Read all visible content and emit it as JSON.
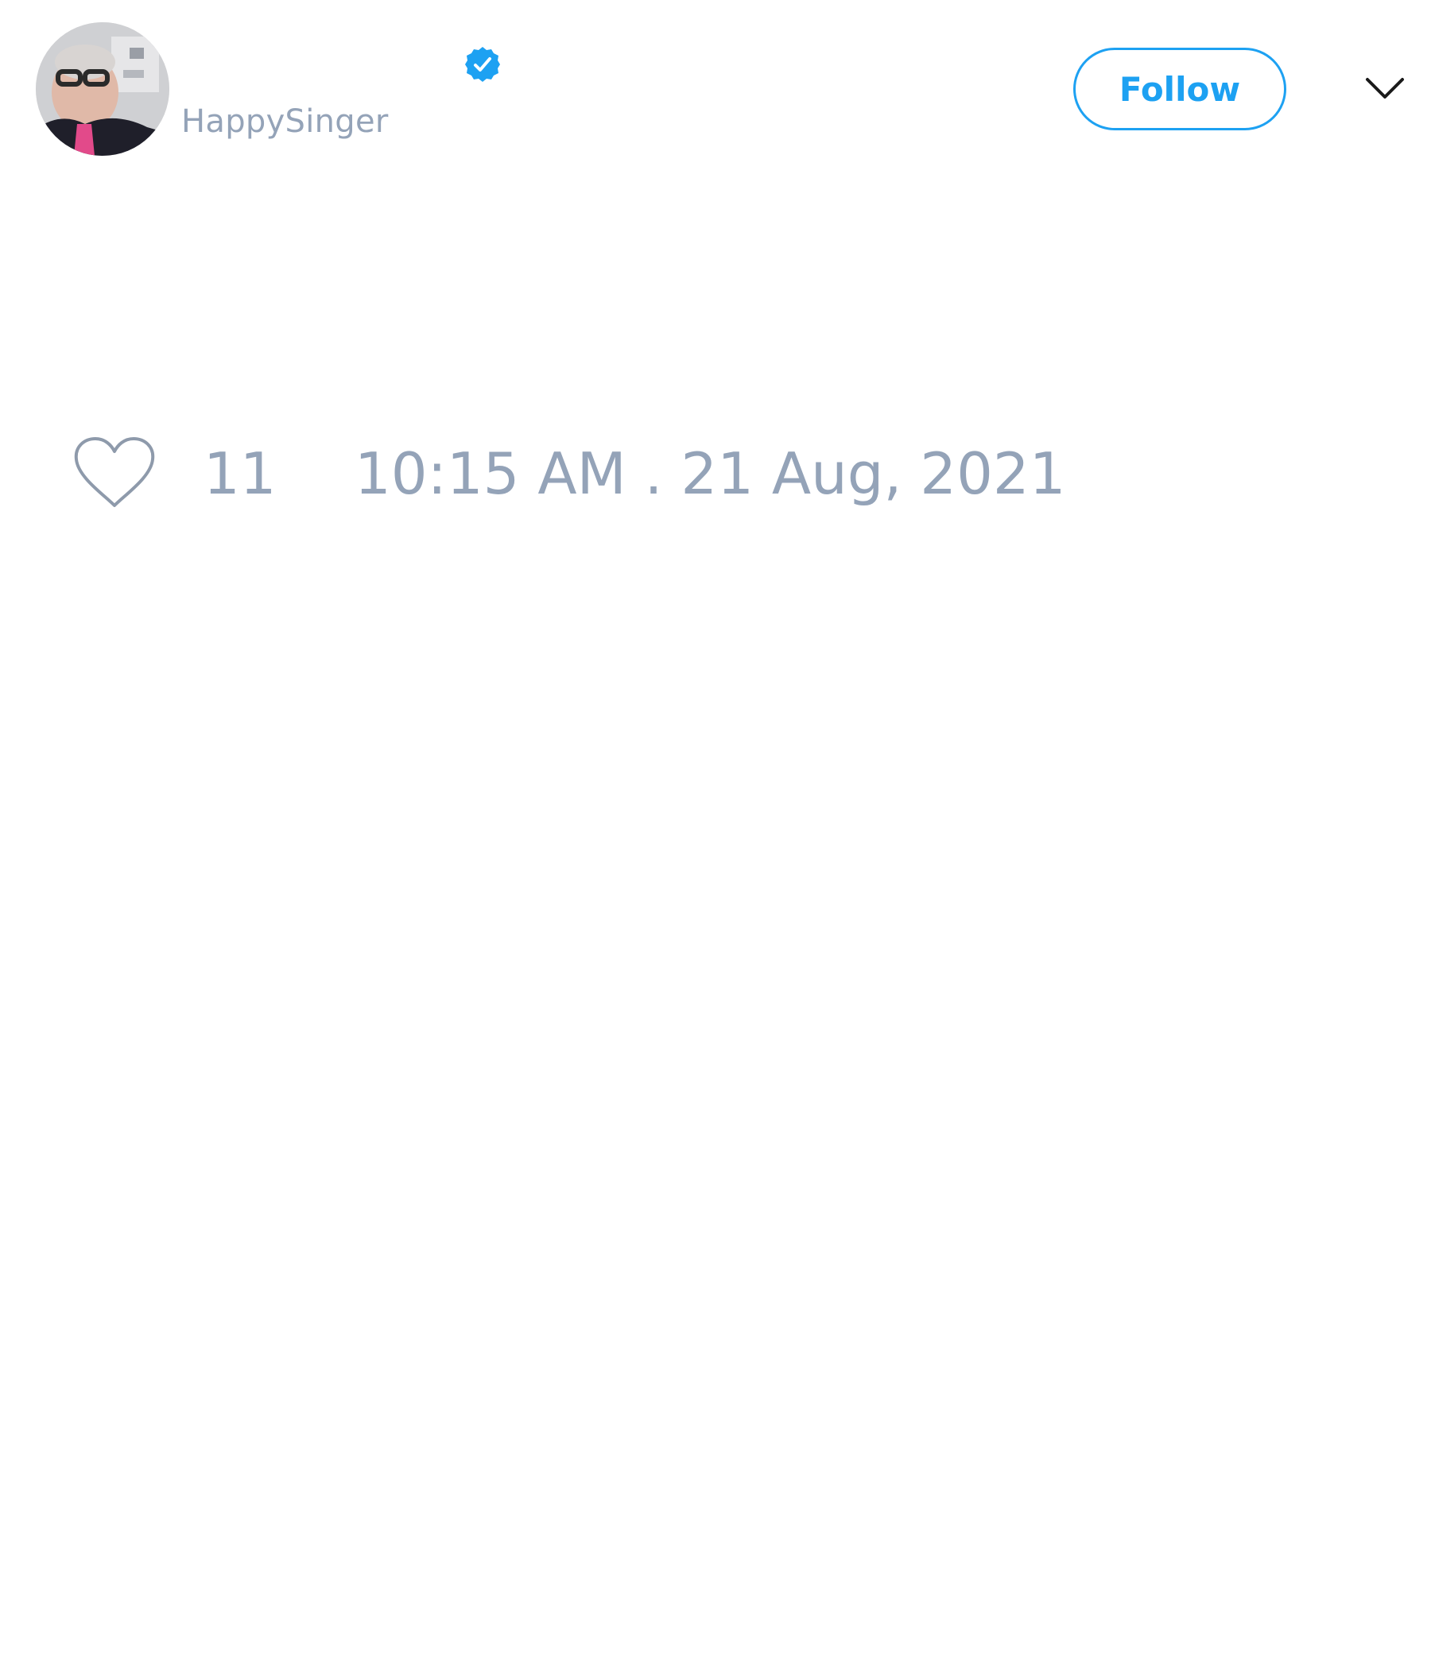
{
  "author": {
    "username": "HappySinger",
    "verified": true,
    "avatar": "profile-photo"
  },
  "header": {
    "follow_label": "Follow",
    "menu_icon": "chevron-down-icon"
  },
  "engagement": {
    "like_icon": "heart-outline-icon",
    "like_count": "11",
    "timestamp": "10:15 AM . 21 Aug, 2021"
  },
  "colors": {
    "accent": "#1da1f2",
    "muted_text": "#94a3b8",
    "background": "#ffffff"
  }
}
